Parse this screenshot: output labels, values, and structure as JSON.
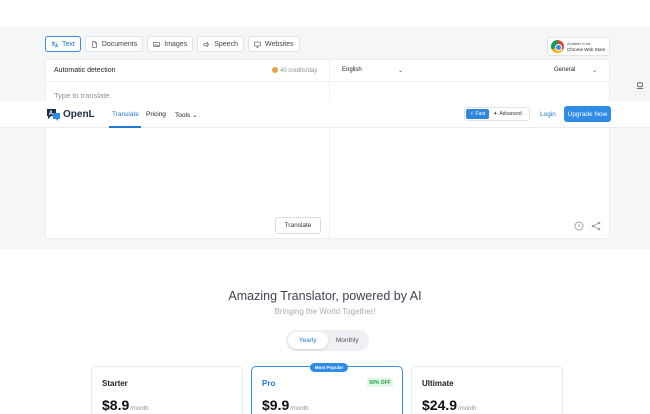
{
  "mode_tabs": [
    {
      "label": "Text",
      "icon": "translate-icon",
      "active": true
    },
    {
      "label": "Documents",
      "icon": "document-icon",
      "active": false
    },
    {
      "label": "Images",
      "icon": "image-icon",
      "active": false
    },
    {
      "label": "Speech",
      "icon": "speaker-icon",
      "active": false
    },
    {
      "label": "Websites",
      "icon": "monitor-icon",
      "active": false
    }
  ],
  "chrome_badge": {
    "line1": "Available in the",
    "line2": "Chrome Web Store"
  },
  "translator": {
    "source_language": "Automatic detection",
    "credits": "40 credits/day",
    "target_language": "English",
    "style": "General",
    "placeholder": "Type to translate.",
    "translate_button": "Translate"
  },
  "navbar": {
    "brand": "OpenL",
    "items": [
      "Translate",
      "Pricing",
      "Tools"
    ],
    "active_item": "Translate",
    "mode_fast": "Fast",
    "mode_advanced": "Advanced",
    "login": "Login",
    "upgrade": "Upgrade Now"
  },
  "pricing": {
    "title": "Amazing Translator, powered by AI",
    "subtitle": "Bringing the World Together!",
    "billing": {
      "yearly": "Yearly",
      "monthly": "Monthly",
      "selected": "Yearly"
    },
    "plans": [
      {
        "name": "Starter",
        "price": "$8.9",
        "period": "/month"
      },
      {
        "name": "Pro",
        "price": "$9.9",
        "period": "/month",
        "badge": "Most Popular",
        "discount": "50% OFF"
      },
      {
        "name": "Ultimate",
        "price": "$24.9",
        "period": "/month"
      }
    ]
  },
  "colors": {
    "accent": "#2e8be6",
    "panel_bg": "#f5f6f8",
    "discount_green": "#22a046"
  }
}
